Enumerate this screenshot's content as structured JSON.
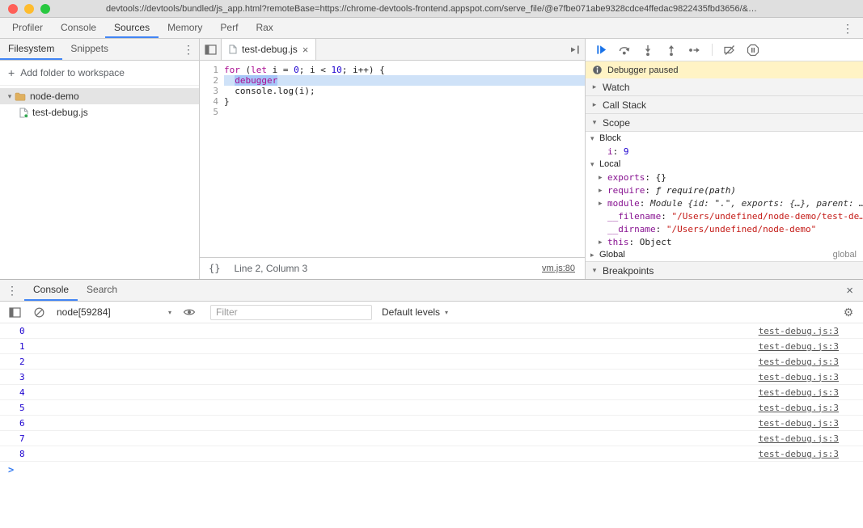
{
  "colors": {
    "accent": "#4285f4",
    "keyword": "#aa0d91",
    "number": "#1c00cf",
    "string": "#c41a16",
    "property": "#881391",
    "link": "#545454",
    "exec_line": "#cfe2f8",
    "exec_token": "#a6c6f7",
    "paused_bg": "#fff3c5"
  },
  "icons": {
    "kebab": "⋮",
    "close": "×",
    "gear": "⚙",
    "plus": "+",
    "collapsed": "▸",
    "expanded": "▾",
    "dropdown": "▾",
    "prompt": ">",
    "braces": "{}"
  },
  "titlebar": {
    "url": "devtools://devtools/bundled/js_app.html?remoteBase=https://chrome-devtools-frontend.appspot.com/serve_file/@e7fbe071abe9328cdce4ffedac9822435fbd3656/&…"
  },
  "main_tabs": {
    "items": [
      {
        "label": "Profiler",
        "active": false
      },
      {
        "label": "Console",
        "active": false
      },
      {
        "label": "Sources",
        "active": true
      },
      {
        "label": "Memory",
        "active": false
      },
      {
        "label": "Perf",
        "active": false
      },
      {
        "label": "Rax",
        "active": false
      }
    ]
  },
  "navigator": {
    "tabs": [
      {
        "label": "Filesystem",
        "active": true
      },
      {
        "label": "Snippets",
        "active": false
      }
    ],
    "add_folder_label": "Add folder to workspace",
    "tree": [
      {
        "label": "node-demo",
        "type": "folder",
        "expanded": true,
        "selected": true
      },
      {
        "label": "test-debug.js",
        "type": "file",
        "selected": false
      }
    ]
  },
  "editor": {
    "tab_label": "test-debug.js",
    "status_text": "Line 2, Column 3",
    "source_link": "vm.js:80",
    "lines": [
      {
        "num": "1",
        "exec": false,
        "tokens": [
          {
            "t": "for",
            "s": "kw"
          },
          {
            "t": " (",
            "s": "pl"
          },
          {
            "t": "let",
            "s": "kw"
          },
          {
            "t": " i = ",
            "s": "pl"
          },
          {
            "t": "0",
            "s": "num"
          },
          {
            "t": "; i < ",
            "s": "pl"
          },
          {
            "t": "10",
            "s": "num"
          },
          {
            "t": "; i++) {",
            "s": "pl"
          }
        ]
      },
      {
        "num": "2",
        "exec": true,
        "tokens": [
          {
            "t": "  ",
            "s": "pl"
          },
          {
            "t": "debugger",
            "s": "kw exec"
          }
        ]
      },
      {
        "num": "3",
        "exec": false,
        "tokens": [
          {
            "t": "  console.log(i);",
            "s": "pl"
          }
        ]
      },
      {
        "num": "4",
        "exec": false,
        "tokens": [
          {
            "t": "}",
            "s": "pl"
          }
        ]
      },
      {
        "num": "5",
        "exec": false,
        "tokens": []
      }
    ]
  },
  "debugger": {
    "paused_message": "Debugger paused",
    "panes": {
      "watch": "Watch",
      "call_stack": "Call Stack",
      "scope": "Scope",
      "breakpoints": "Breakpoints"
    },
    "scope_rows": [
      {
        "kind": "section",
        "arrow": "expanded",
        "name": "Block"
      },
      {
        "kind": "prop",
        "arrow": "",
        "name": "i",
        "values": [
          {
            "t": "9",
            "s": "num"
          }
        ]
      },
      {
        "kind": "section",
        "arrow": "expanded",
        "name": "Local"
      },
      {
        "kind": "prop",
        "arrow": "collapsed",
        "name": "exports",
        "values": [
          {
            "t": "{}",
            "s": "plain"
          }
        ]
      },
      {
        "kind": "prop",
        "arrow": "collapsed",
        "name": "require",
        "values": [
          {
            "t": "ƒ require(path)",
            "s": "fn"
          }
        ]
      },
      {
        "kind": "prop",
        "arrow": "collapsed",
        "name": "module",
        "values": [
          {
            "t": "Module {id: ",
            "s": "prev"
          },
          {
            "t": "\".\"",
            "s": "strp"
          },
          {
            "t": ", exports: {…}, parent: …",
            "s": "prev"
          }
        ]
      },
      {
        "kind": "prop",
        "arrow": "",
        "name": "__filename",
        "values": [
          {
            "t": "\"/Users/undefined/node-demo/test-de…",
            "s": "str"
          }
        ]
      },
      {
        "kind": "prop",
        "arrow": "",
        "name": "__dirname",
        "values": [
          {
            "t": "\"/Users/undefined/node-demo\"",
            "s": "str"
          }
        ]
      },
      {
        "kind": "prop",
        "arrow": "collapsed",
        "name": "this",
        "values": [
          {
            "t": "Object",
            "s": "plain"
          }
        ]
      },
      {
        "kind": "section",
        "arrow": "collapsed",
        "name": "Global",
        "right": "global"
      }
    ]
  },
  "console": {
    "tabs": [
      {
        "label": "Console",
        "active": true
      },
      {
        "label": "Search",
        "active": false
      }
    ],
    "context": "node[59284]",
    "filter_placeholder": "Filter",
    "levels_label": "Default levels",
    "messages": [
      {
        "value": "0",
        "link": "test-debug.js:3"
      },
      {
        "value": "1",
        "link": "test-debug.js:3"
      },
      {
        "value": "2",
        "link": "test-debug.js:3"
      },
      {
        "value": "3",
        "link": "test-debug.js:3"
      },
      {
        "value": "4",
        "link": "test-debug.js:3"
      },
      {
        "value": "5",
        "link": "test-debug.js:3"
      },
      {
        "value": "6",
        "link": "test-debug.js:3"
      },
      {
        "value": "7",
        "link": "test-debug.js:3"
      },
      {
        "value": "8",
        "link": "test-debug.js:3"
      }
    ]
  }
}
